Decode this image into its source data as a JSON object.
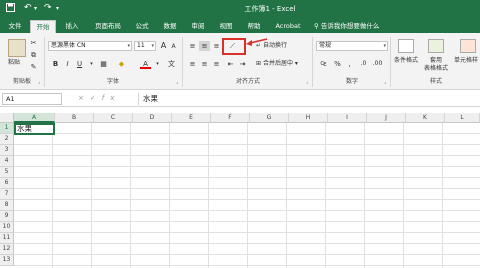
{
  "window": {
    "title": "工作簿1 - Excel",
    "quick_access": {
      "save_icon": "save-icon",
      "undo_icon": "undo-icon",
      "redo_icon": "redo-icon",
      "customize_icon": "customize-qat-icon"
    }
  },
  "tabs": [
    "文件",
    "开始",
    "插入",
    "页面布局",
    "公式",
    "数据",
    "审阅",
    "视图",
    "帮助",
    "Acrobat"
  ],
  "active_tab": "开始",
  "tell_me": "告诉我你想要做什么",
  "ribbon": {
    "clipboard": {
      "paste": "粘贴",
      "label": "剪贴板",
      "cut_icon": "cut-icon",
      "copy_icon": "copy-icon",
      "format_painter_icon": "format-painter-icon"
    },
    "font": {
      "font_name": "思源黑体 CN",
      "font_size": "11",
      "grow": "A",
      "shrink": "A",
      "bold": "B",
      "italic": "I",
      "underline": "U",
      "font_color_letter": "A",
      "label": "字体"
    },
    "alignment": {
      "wrap_text": "自动换行",
      "merge_center": "合并后居中",
      "label": "对齐方式",
      "orientation_icon": "text-orientation-icon"
    },
    "number": {
      "format": "常规",
      "label": "数字"
    },
    "styles": {
      "conditional": "条件格式",
      "table_line1": "套用",
      "table_line2": "表格格式",
      "cell_styles": "单元格样",
      "label": "样式"
    },
    "annotation_color": "#d8312a"
  },
  "formula_bar": {
    "name_box": "A1",
    "cancel": "×",
    "enter": "✓",
    "fx": "fx",
    "value": "水果"
  },
  "sheet": {
    "columns": [
      "A",
      "B",
      "C",
      "D",
      "E",
      "F",
      "G",
      "H",
      "I",
      "J",
      "K",
      "L"
    ],
    "rows": [
      "1",
      "2",
      "3",
      "4",
      "5",
      "6",
      "7",
      "8",
      "9",
      "10",
      "11",
      "12",
      "13"
    ],
    "active_cell_value": "水果"
  },
  "colors": {
    "accent": "#217346"
  }
}
